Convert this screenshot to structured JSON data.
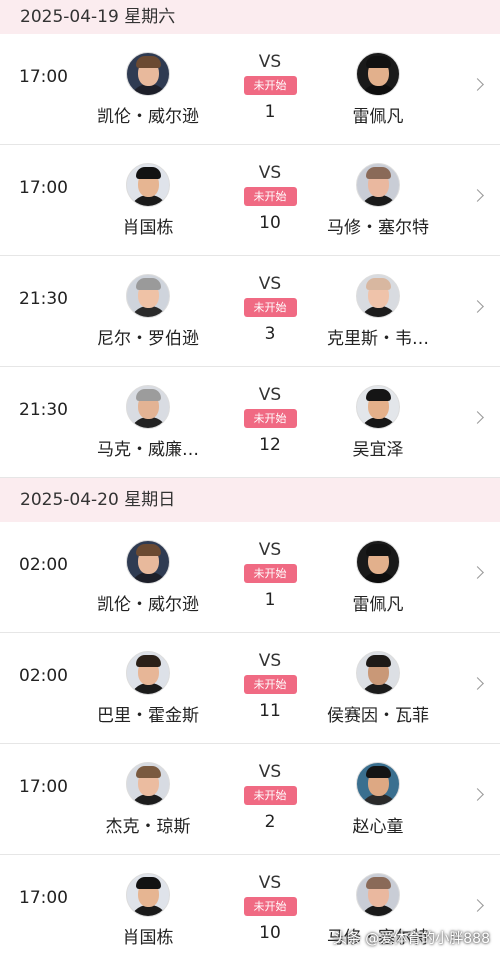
{
  "days": [
    {
      "date": "2025-04-19 星期六",
      "matches": [
        {
          "time": "17:00",
          "home": "凯伦・威尔逊",
          "away": "雷佩凡",
          "status": "未开始",
          "round": "1",
          "home_avatar": {
            "skin": "#e8b99c",
            "hair": "#6b4a32",
            "bg": "#2f3b52",
            "shirt": "#1d1f29"
          },
          "away_avatar": {
            "skin": "#e2b08c",
            "hair": "#111111",
            "bg": "#1a1a1a",
            "shirt": "#0e0e0e"
          }
        },
        {
          "time": "17:00",
          "home": "肖国栋",
          "away": "马修・塞尔特",
          "status": "未开始",
          "round": "10",
          "home_avatar": {
            "skin": "#e6b592",
            "hair": "#121212",
            "bg": "#dfe3ea",
            "shirt": "#1a1a1a"
          },
          "away_avatar": {
            "skin": "#eab89f",
            "hair": "#8a6a58",
            "bg": "#c9cdd6",
            "shirt": "#1a1a1a"
          }
        },
        {
          "time": "21:30",
          "home": "尼尔・罗伯逊",
          "away": "克里斯・韦…",
          "status": "未开始",
          "round": "3",
          "home_avatar": {
            "skin": "#efc2a6",
            "hair": "#9a9a9a",
            "bg": "#cfd4dc",
            "shirt": "#2a2a2a"
          },
          "away_avatar": {
            "skin": "#efc3aa",
            "hair": "#d8b7a0",
            "bg": "#d8dbe0",
            "shirt": "#1c1c1c"
          }
        },
        {
          "time": "21:30",
          "home": "马克・威廉…",
          "away": "吴宜泽",
          "status": "未开始",
          "round": "12",
          "home_avatar": {
            "skin": "#e3b394",
            "hair": "#9c9c9c",
            "bg": "#d9dce2",
            "shirt": "#222222"
          },
          "away_avatar": {
            "skin": "#e4b08a",
            "hair": "#151515",
            "bg": "#e3e6ea",
            "shirt": "#161616"
          }
        }
      ]
    },
    {
      "date": "2025-04-20 星期日",
      "matches": [
        {
          "time": "02:00",
          "home": "凯伦・威尔逊",
          "away": "雷佩凡",
          "status": "未开始",
          "round": "1",
          "home_avatar": {
            "skin": "#e8b99c",
            "hair": "#6b4a32",
            "bg": "#2f3b52",
            "shirt": "#1d1f29"
          },
          "away_avatar": {
            "skin": "#e2b08c",
            "hair": "#111111",
            "bg": "#1a1a1a",
            "shirt": "#0e0e0e"
          }
        },
        {
          "time": "02:00",
          "home": "巴里・霍金斯",
          "away": "侯赛因・瓦菲",
          "status": "未开始",
          "round": "11",
          "home_avatar": {
            "skin": "#e7b697",
            "hair": "#2b2018",
            "bg": "#dde1e8",
            "shirt": "#1b1b1b"
          },
          "away_avatar": {
            "skin": "#c99877",
            "hair": "#1e1a17",
            "bg": "#dcdfe4",
            "shirt": "#1b1b1b"
          }
        },
        {
          "time": "17:00",
          "home": "杰克・琼斯",
          "away": "赵心童",
          "status": "未开始",
          "round": "2",
          "home_avatar": {
            "skin": "#ebbca0",
            "hair": "#7a5a40",
            "bg": "#d7dbe2",
            "shirt": "#1d1d1d"
          },
          "away_avatar": {
            "skin": "#dda883",
            "hair": "#141414",
            "bg": "#3a6f8f",
            "shirt": "#2a2a2a"
          }
        },
        {
          "time": "17:00",
          "home": "肖国栋",
          "away": "马修・塞尔特",
          "status": "未开始",
          "round": "10",
          "home_avatar": {
            "skin": "#e6b592",
            "hair": "#121212",
            "bg": "#dfe3ea",
            "shirt": "#1a1a1a"
          },
          "away_avatar": {
            "skin": "#eab89f",
            "hair": "#8a6a58",
            "bg": "#c9cdd6",
            "shirt": "#1a1a1a"
          }
        }
      ]
    }
  ],
  "vs_label": "VS",
  "watermark": "头条 @爱体育的小胖888",
  "colors": {
    "header_bg": "#fbecef",
    "status_badge": "#f06a83"
  },
  "icons": {
    "row_action": "chevron-right-icon"
  }
}
